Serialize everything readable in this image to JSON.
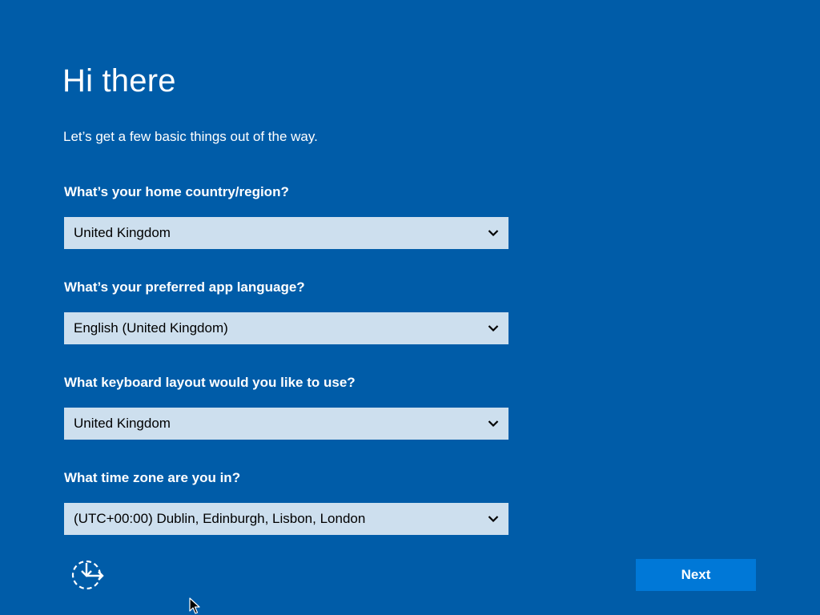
{
  "header": {
    "title": "Hi there",
    "subtitle": "Let’s get a few basic things out of the way."
  },
  "questions": [
    {
      "label": "What’s your home country/region?",
      "selected": "United Kingdom"
    },
    {
      "label": "What’s your preferred app language?",
      "selected": "English (United Kingdom)"
    },
    {
      "label": "What keyboard layout would you like to use?",
      "selected": "United Kingdom"
    },
    {
      "label": "What time zone are you in?",
      "selected": "(UTC+00:00) Dublin, Edinburgh, Lisbon, London"
    }
  ],
  "footer": {
    "next_label": "Next",
    "ease_of_access_icon": "ease-of-access-icon"
  },
  "colors": {
    "background": "#005ca8",
    "select_bg": "#cddfee",
    "button_bg": "#0078d7",
    "text": "#ffffff"
  }
}
